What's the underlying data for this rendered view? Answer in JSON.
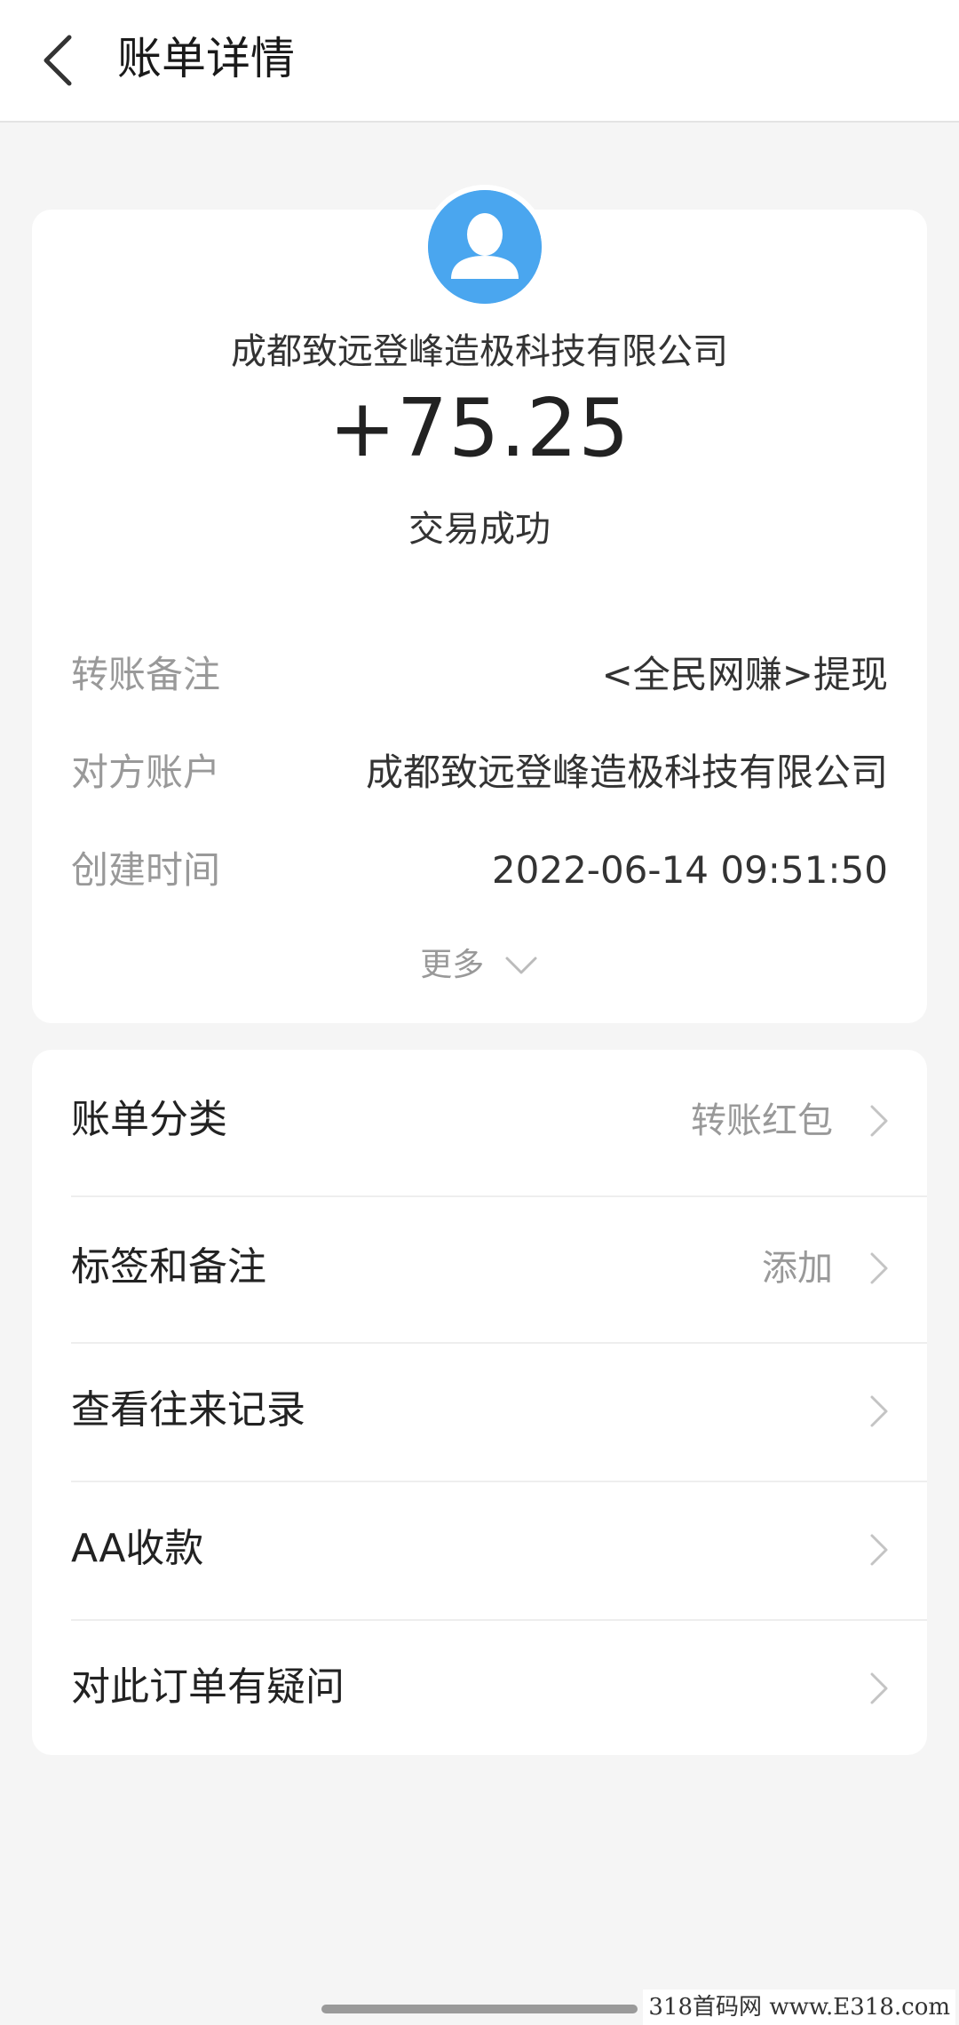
{
  "header": {
    "title": "账单详情"
  },
  "transaction": {
    "payer_name": "成都致远登峰造极科技有限公司",
    "amount": "+75.25",
    "status": "交易成功",
    "avatar_color": "#4aa6ef"
  },
  "details": [
    {
      "label": "转账备注",
      "value": "<全民网赚>提现"
    },
    {
      "label": "对方账户",
      "value": "成都致远登峰造极科技有限公司"
    },
    {
      "label": "创建时间",
      "value": "2022-06-14 09:51:50"
    }
  ],
  "more": {
    "label": "更多"
  },
  "menu": [
    {
      "label": "账单分类",
      "value": "转账红包"
    },
    {
      "label": "标签和备注",
      "value": "添加"
    },
    {
      "label": "查看往来记录",
      "value": ""
    },
    {
      "label": "AA收款",
      "value": ""
    },
    {
      "label": "对此订单有疑问",
      "value": ""
    }
  ],
  "watermark": "318首码网 www.E318.com"
}
